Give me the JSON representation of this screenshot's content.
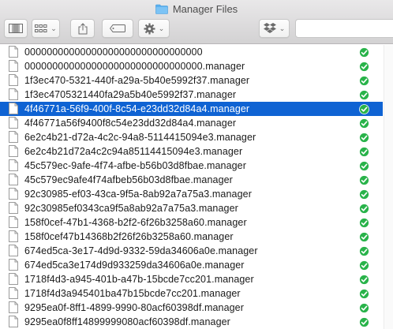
{
  "window": {
    "title": "Manager Files",
    "icons": {
      "title": "folder-icon",
      "view": "column-view-icon",
      "arrange": "grid-arrange-icon",
      "share": "share-icon",
      "tag": "tag-icon",
      "action": "gear-icon",
      "dropbox": "dropbox-icon",
      "file": "document-icon",
      "status": "sync-check-icon"
    }
  },
  "colors": {
    "selection": "#0f63d3",
    "status_green": "#29b34a",
    "folder_blue": "#5bb0ef"
  },
  "files": [
    {
      "name": "00000000000000000000000000000000"
    },
    {
      "name": "00000000000000000000000000000000.manager"
    },
    {
      "name": "1f3ec470-5321-440f-a29a-5b40e5992f37.manager"
    },
    {
      "name": "1f3ec4705321440fa29a5b40e5992f37.manager"
    },
    {
      "name": "4f46771a-56f9-400f-8c54-e23dd32d84a4.manager",
      "selected": true
    },
    {
      "name": "4f46771a56f9400f8c54e23dd32d84a4.manager"
    },
    {
      "name": "6e2c4b21-d72a-4c2c-94a8-5114415094e3.manager"
    },
    {
      "name": "6e2c4b21d72a4c2c94a85114415094e3.manager"
    },
    {
      "name": "45c579ec-9afe-4f74-afbe-b56b03d8fbae.manager"
    },
    {
      "name": "45c579ec9afe4f74afbeb56b03d8fbae.manager"
    },
    {
      "name": "92c30985-ef03-43ca-9f5a-8ab92a7a75a3.manager"
    },
    {
      "name": "92c30985ef0343ca9f5a8ab92a7a75a3.manager"
    },
    {
      "name": "158f0cef-47b1-4368-b2f2-6f26b3258a60.manager"
    },
    {
      "name": "158f0cef47b14368b2f26f26b3258a60.manager"
    },
    {
      "name": "674ed5ca-3e17-4d9d-9332-59da34606a0e.manager"
    },
    {
      "name": "674ed5ca3e174d9d933259da34606a0e.manager"
    },
    {
      "name": "1718f4d3-a945-401b-a47b-15bcde7cc201.manager"
    },
    {
      "name": "1718f4d3a945401ba47b15bcde7cc201.manager"
    },
    {
      "name": "9295ea0f-8ff1-4899-9990-80acf60398df.manager"
    },
    {
      "name": "9295ea0f8ff14899999080acf60398df.manager"
    }
  ]
}
